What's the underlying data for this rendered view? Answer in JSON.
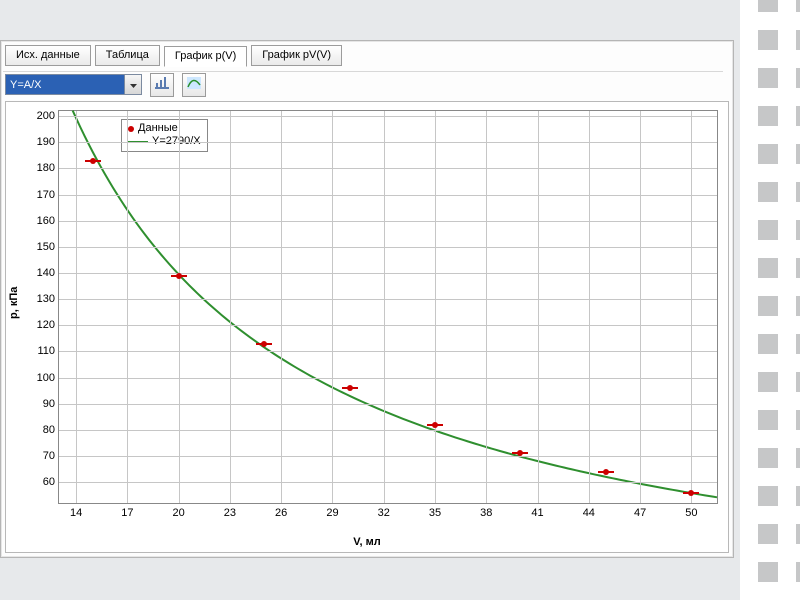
{
  "tabs": [
    {
      "id": "raw",
      "label": "Исх. данные"
    },
    {
      "id": "table",
      "label": "Таблица"
    },
    {
      "id": "pv",
      "label": "График p(V)"
    },
    {
      "id": "pvv",
      "label": "График pV(V)"
    }
  ],
  "active_tab": 2,
  "fit_selector": {
    "value": "Y=A/X"
  },
  "legend": {
    "series_data": "Данные",
    "series_fit": "Y=2790/X"
  },
  "xlabel": "V, мл",
  "ylabel": "p, кПа",
  "chart_data": {
    "type": "scatter",
    "title": "",
    "xlabel": "V, мл",
    "ylabel": "p, кПа",
    "xticks": [
      14,
      17,
      20,
      23,
      26,
      29,
      32,
      35,
      38,
      41,
      44,
      47,
      50
    ],
    "yticks": [
      60,
      70,
      80,
      90,
      100,
      110,
      120,
      130,
      140,
      150,
      160,
      170,
      180,
      190,
      200
    ],
    "xlim": [
      13,
      51.5
    ],
    "ylim": [
      52,
      202
    ],
    "series": [
      {
        "name": "Данные",
        "kind": "points",
        "color": "#cc0000",
        "x": [
          15,
          20,
          25,
          30,
          35,
          40,
          45,
          50
        ],
        "y": [
          183,
          139,
          113,
          96,
          82,
          71,
          64,
          56
        ]
      },
      {
        "name": "Y=2790/X",
        "kind": "curve",
        "color": "#2f8f2f",
        "formula": "2790/x",
        "x_range": [
          13.8,
          51.5
        ]
      }
    ]
  }
}
